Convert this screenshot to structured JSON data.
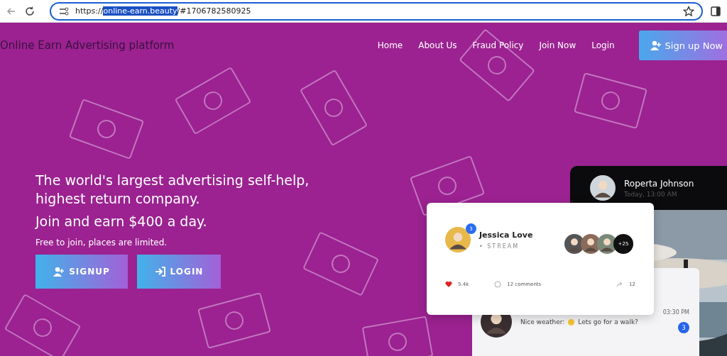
{
  "browser": {
    "url": {
      "prefix": "https://",
      "selected": "online-earn.beauty",
      "rest": "/#1706782580925"
    }
  },
  "nav": {
    "brand": "Online Earn Advertising platform",
    "links": [
      {
        "label": "Home"
      },
      {
        "label": "About Us"
      },
      {
        "label": "Fraud Policy"
      },
      {
        "label": "Join Now"
      },
      {
        "label": "Login"
      }
    ],
    "cta": "Sign up Now"
  },
  "hero": {
    "headline": "The world's largest advertising self-help, highest return company.",
    "subheadline": "Join and earn $400 a day.",
    "note": "Free to join, places are limited.",
    "buttons": [
      {
        "label": "SIGNUP",
        "kind": "signup"
      },
      {
        "label": "LOGIN",
        "kind": "login"
      }
    ]
  },
  "mockup": {
    "profile_card": {
      "name": "Roperta Johnson",
      "time": "Today, 13:00 AM"
    },
    "stream_card": {
      "name": "Jessica Love",
      "badge": "3",
      "subtitle": "• STREAM",
      "extra_viewers": "+25",
      "likes": "5.4k",
      "comments": "12 comments",
      "shares": "12"
    },
    "chat_card": {
      "time": "03:30 PM",
      "message_start": "Nice weather:",
      "message_end": "Lets go for a walk?",
      "unread": "3"
    }
  }
}
